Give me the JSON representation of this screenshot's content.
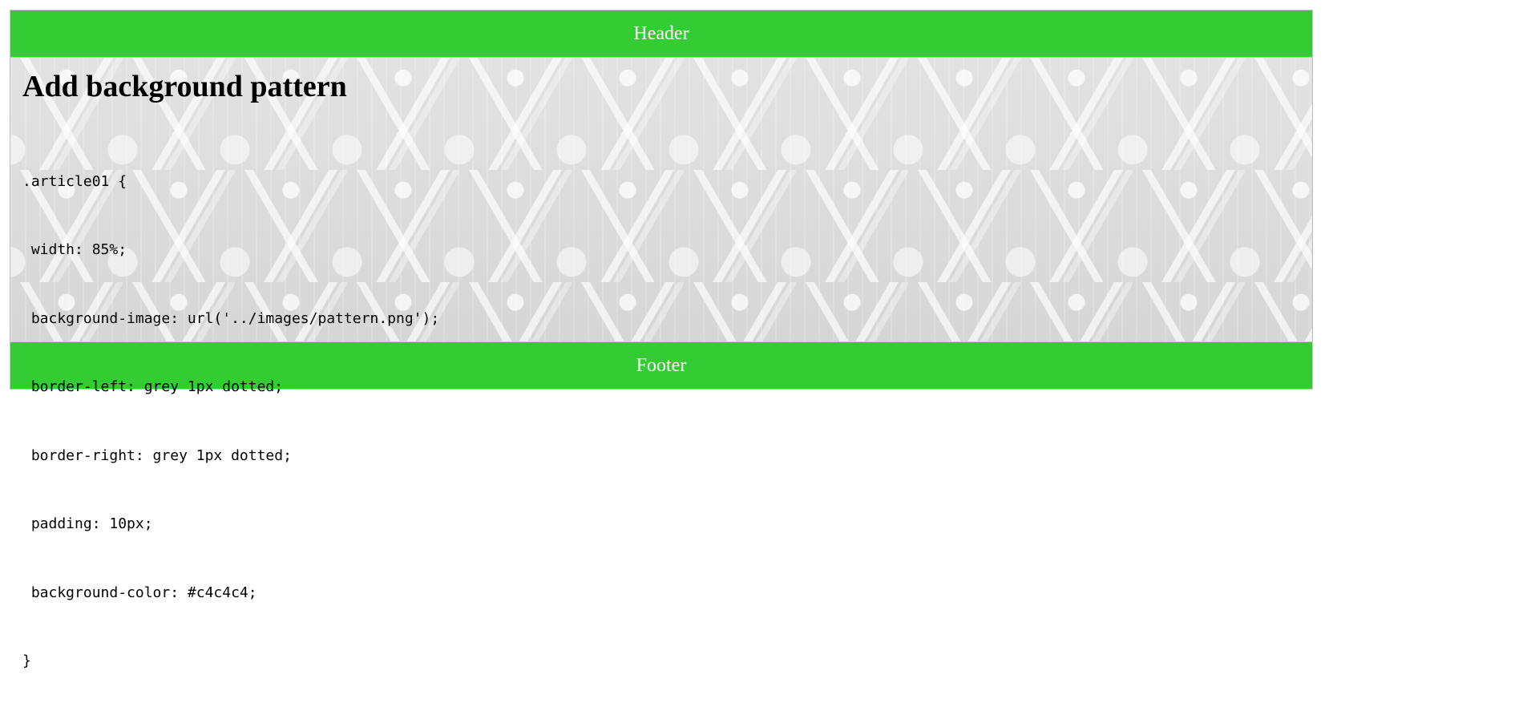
{
  "header": {
    "label": "Header"
  },
  "article": {
    "title": "Add background pattern",
    "code_lines": [
      ".article01 {",
      " width: 85%;",
      " background-image: url('../images/pattern.png');",
      " border-left: grey 1px dotted;",
      " border-right: grey 1px dotted;",
      " padding: 10px;",
      " background-color: #c4c4c4;",
      "}"
    ]
  },
  "footer": {
    "label": "Footer"
  },
  "colors": {
    "bar_green": "#33cc33",
    "bar_text": "#ffffff",
    "pattern_base": "#dcdcdc"
  }
}
